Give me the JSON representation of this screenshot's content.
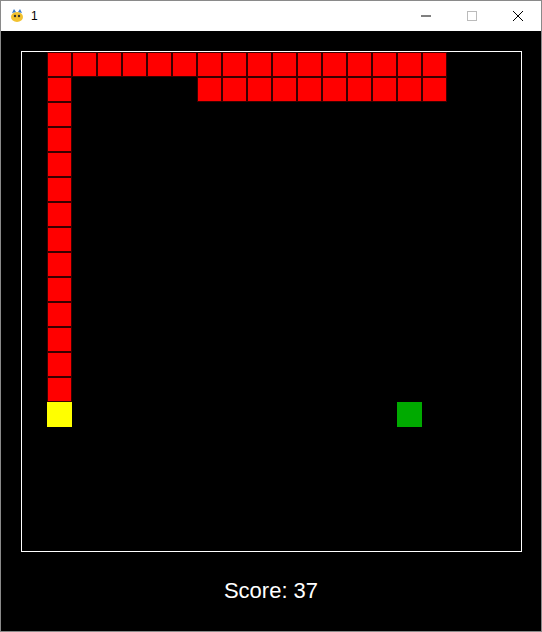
{
  "window": {
    "title": "1"
  },
  "board": {
    "cols": 20,
    "rows": 20
  },
  "snake": [
    {
      "col": 1,
      "row": 14,
      "kind": "head"
    },
    {
      "col": 1,
      "row": 13,
      "kind": "body"
    },
    {
      "col": 1,
      "row": 12,
      "kind": "body"
    },
    {
      "col": 1,
      "row": 11,
      "kind": "body"
    },
    {
      "col": 1,
      "row": 10,
      "kind": "body"
    },
    {
      "col": 1,
      "row": 9,
      "kind": "body"
    },
    {
      "col": 1,
      "row": 8,
      "kind": "body"
    },
    {
      "col": 1,
      "row": 7,
      "kind": "body"
    },
    {
      "col": 1,
      "row": 6,
      "kind": "body"
    },
    {
      "col": 1,
      "row": 5,
      "kind": "body"
    },
    {
      "col": 1,
      "row": 4,
      "kind": "body"
    },
    {
      "col": 1,
      "row": 3,
      "kind": "body"
    },
    {
      "col": 1,
      "row": 2,
      "kind": "body"
    },
    {
      "col": 1,
      "row": 1,
      "kind": "body"
    },
    {
      "col": 1,
      "row": 0,
      "kind": "body"
    },
    {
      "col": 2,
      "row": 0,
      "kind": "body"
    },
    {
      "col": 3,
      "row": 0,
      "kind": "body"
    },
    {
      "col": 4,
      "row": 0,
      "kind": "body"
    },
    {
      "col": 5,
      "row": 0,
      "kind": "body"
    },
    {
      "col": 6,
      "row": 0,
      "kind": "body"
    },
    {
      "col": 7,
      "row": 0,
      "kind": "body"
    },
    {
      "col": 8,
      "row": 0,
      "kind": "body"
    },
    {
      "col": 9,
      "row": 0,
      "kind": "body"
    },
    {
      "col": 10,
      "row": 0,
      "kind": "body"
    },
    {
      "col": 11,
      "row": 0,
      "kind": "body"
    },
    {
      "col": 12,
      "row": 0,
      "kind": "body"
    },
    {
      "col": 13,
      "row": 0,
      "kind": "body"
    },
    {
      "col": 14,
      "row": 0,
      "kind": "body"
    },
    {
      "col": 15,
      "row": 0,
      "kind": "body"
    },
    {
      "col": 16,
      "row": 0,
      "kind": "body"
    },
    {
      "col": 16,
      "row": 1,
      "kind": "body"
    },
    {
      "col": 15,
      "row": 1,
      "kind": "body"
    },
    {
      "col": 14,
      "row": 1,
      "kind": "body"
    },
    {
      "col": 13,
      "row": 1,
      "kind": "body"
    },
    {
      "col": 12,
      "row": 1,
      "kind": "body"
    },
    {
      "col": 11,
      "row": 1,
      "kind": "body"
    },
    {
      "col": 10,
      "row": 1,
      "kind": "body"
    },
    {
      "col": 9,
      "row": 1,
      "kind": "body"
    },
    {
      "col": 8,
      "row": 1,
      "kind": "body"
    },
    {
      "col": 7,
      "row": 1,
      "kind": "body"
    }
  ],
  "food": {
    "col": 15,
    "row": 14
  },
  "score": "Score: 37"
}
